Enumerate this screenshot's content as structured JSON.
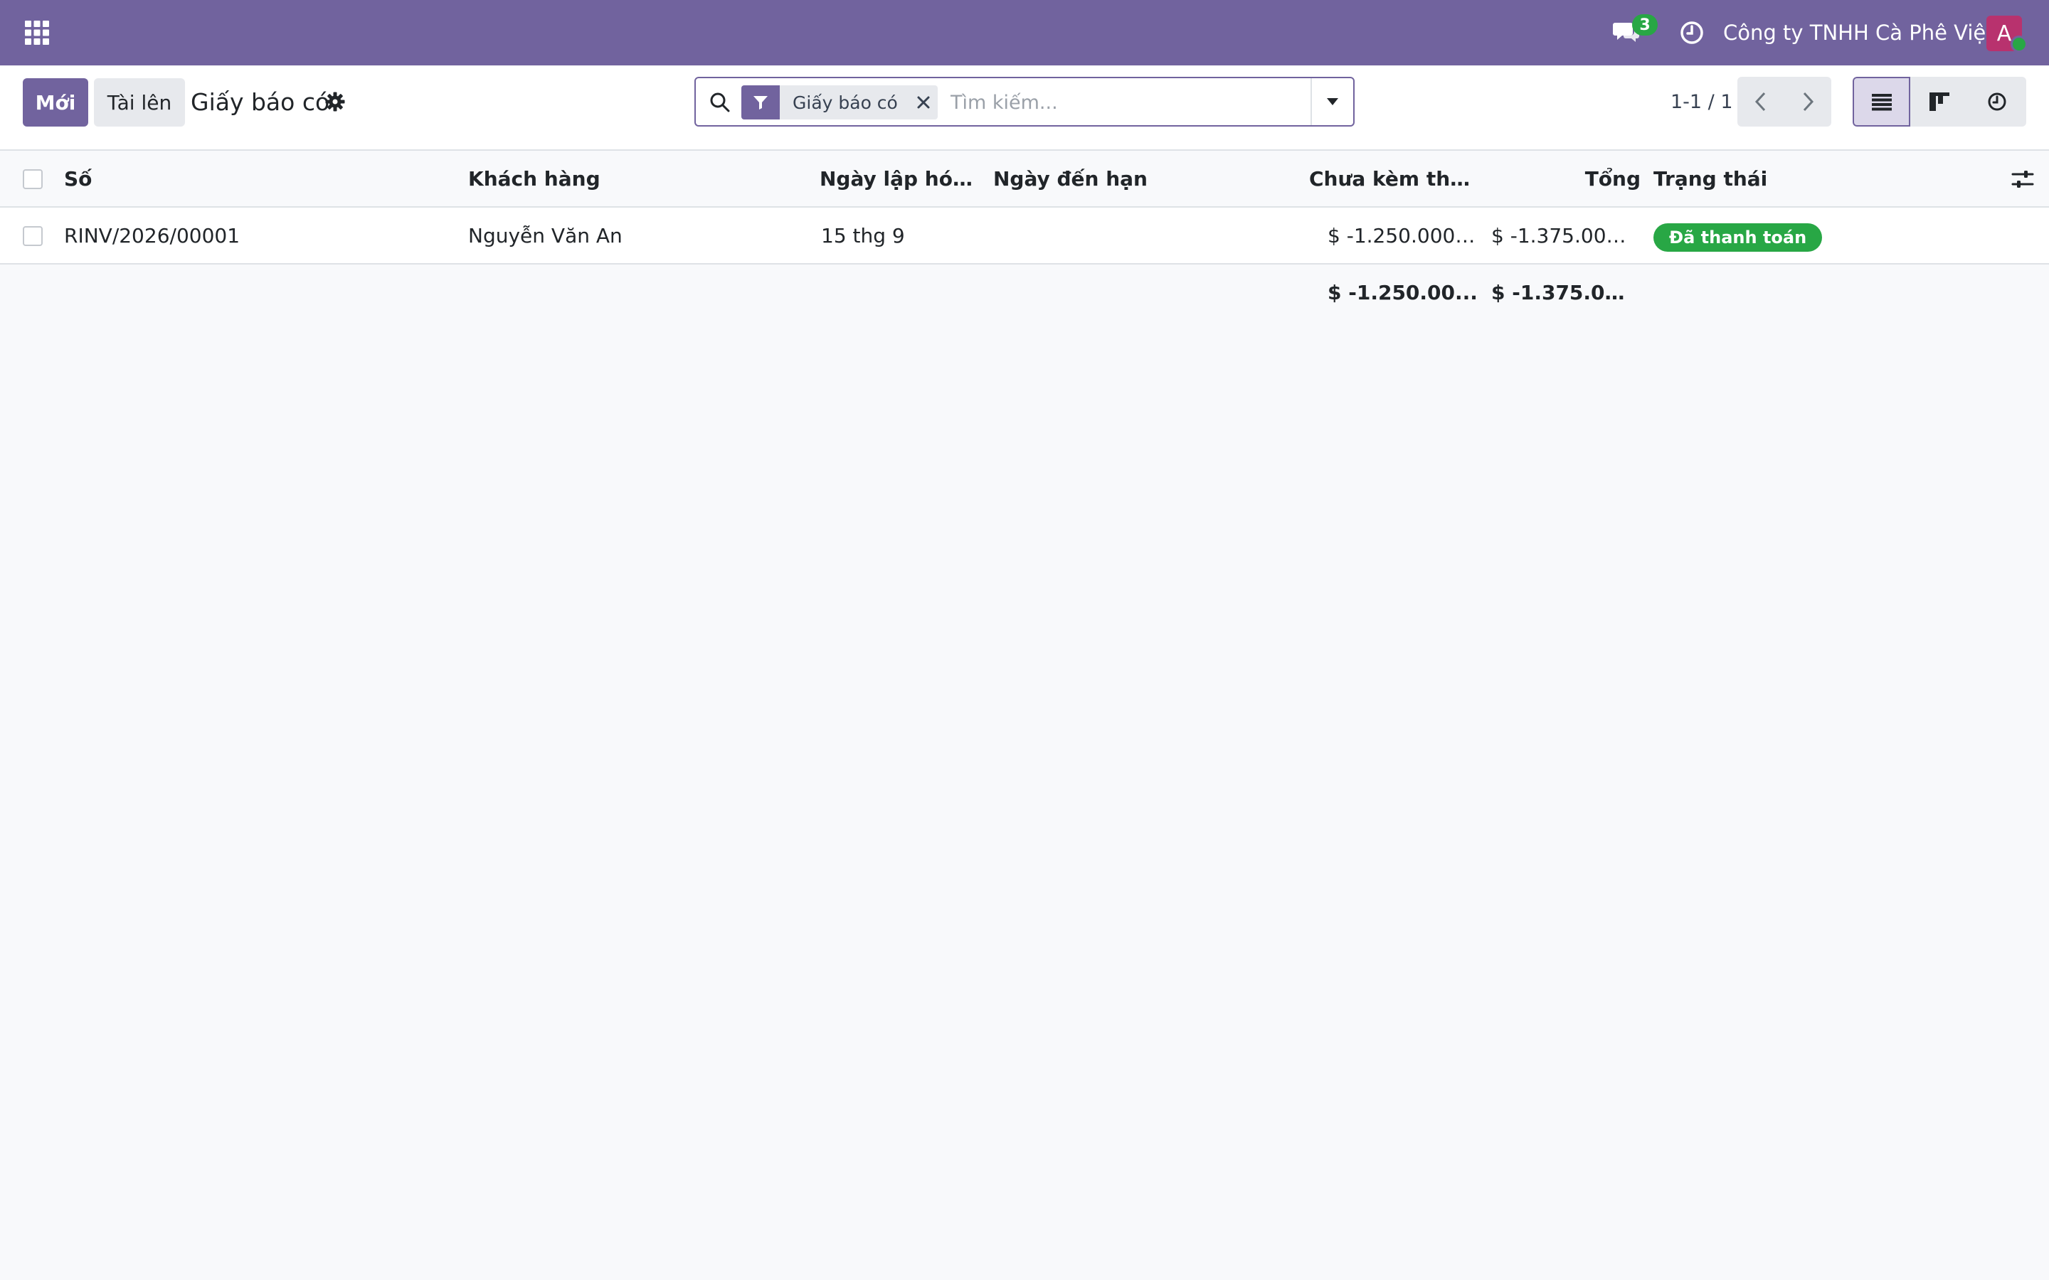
{
  "navbar": {
    "company": "Công ty TNHH Cà Phê Việt",
    "chat_count": "3",
    "avatar_letter": "A",
    "icons": [
      "apps-grid-icon",
      "chat-icon",
      "clock-icon"
    ],
    "colors": {
      "brand": "#71639e",
      "badge": "#28a745",
      "avatar": "#b8326e"
    }
  },
  "control_panel": {
    "new_label": "Mới",
    "upload_label": "Tài lên",
    "title": "Giấy báo có",
    "search": {
      "facet_label": "Giấy báo có",
      "placeholder": "Tìm kiếm..."
    },
    "pager": {
      "value": "1-1 / 1"
    },
    "views": [
      "list-icon",
      "kanban-icon",
      "activity-icon"
    ]
  },
  "table": {
    "columns": {
      "number": "Số",
      "customer": "Khách hàng",
      "invoice_date": "Ngày lập hóa đ...",
      "due_date": "Ngày đến hạn",
      "untaxed": "Chưa kèm thuế",
      "total": "Tổng",
      "status": "Trạng thái"
    },
    "rows": [
      {
        "number": "RINV/2026/00001",
        "customer": "Nguyễn Văn An",
        "invoice_date": "15 thg 9",
        "due_date": "",
        "untaxed": "$ -1.250.000,...",
        "total": "$ -1.375.000...",
        "status": "Đã thanh toán",
        "status_color": "#28a745"
      }
    ],
    "totals": {
      "untaxed": "$ -1.250.00...",
      "total": "$ -1.375.00..."
    }
  }
}
